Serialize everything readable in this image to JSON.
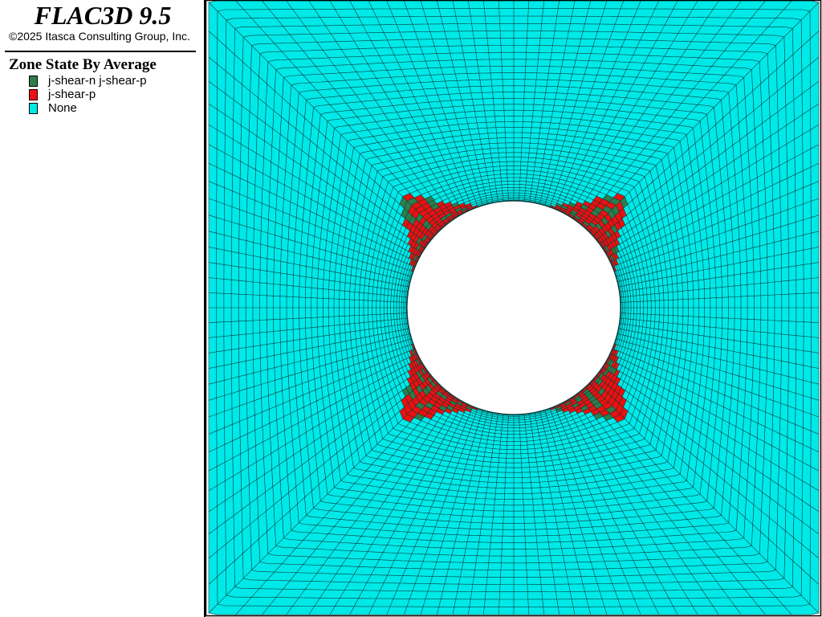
{
  "app": {
    "title": "FLAC3D 9.5",
    "copyright": "©2025 Itasca Consulting Group, Inc."
  },
  "legend": {
    "title": "Zone State By Average",
    "items": [
      {
        "label": "j-shear-n j-shear-p",
        "color": "#2e7d4a"
      },
      {
        "label": "j-shear-p",
        "color": "#ee0f0f"
      },
      {
        "label": "None",
        "color": "#00e9e9"
      }
    ]
  },
  "plot": {
    "background_color": "#00e9e9",
    "mesh_line_color": "#0a3a3a",
    "yield_colors": {
      "j_shear_p": "#ee0f0f",
      "j_shear_n_p": "#2e7d4a"
    }
  }
}
